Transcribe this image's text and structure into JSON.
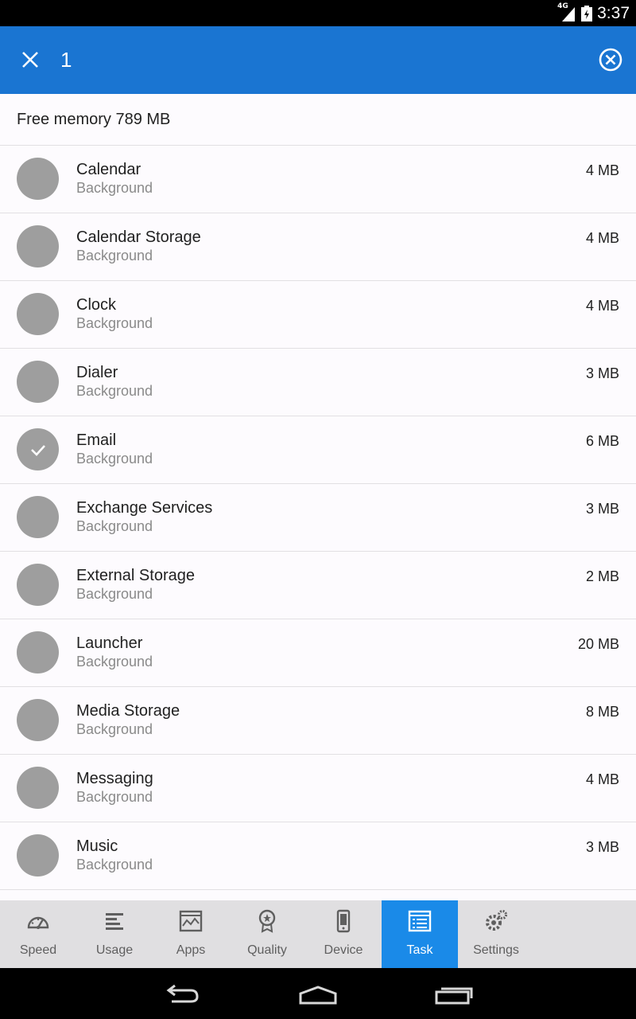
{
  "status_bar": {
    "network": "4G",
    "time": "3:37"
  },
  "action_bar": {
    "selected_count": "1",
    "close_icon": "close-icon",
    "clear_icon": "clear-circle-icon"
  },
  "free_memory": {
    "text": "Free memory 789 MB"
  },
  "tasks": [
    {
      "name": "Calendar",
      "status": "Background",
      "size": "4 MB",
      "selected": false
    },
    {
      "name": "Calendar Storage",
      "status": "Background",
      "size": "4 MB",
      "selected": false
    },
    {
      "name": "Clock",
      "status": "Background",
      "size": "4 MB",
      "selected": false
    },
    {
      "name": "Dialer",
      "status": "Background",
      "size": "3 MB",
      "selected": false
    },
    {
      "name": "Email",
      "status": "Background",
      "size": "6 MB",
      "selected": true
    },
    {
      "name": "Exchange Services",
      "status": "Background",
      "size": "3 MB",
      "selected": false
    },
    {
      "name": "External Storage",
      "status": "Background",
      "size": "2 MB",
      "selected": false
    },
    {
      "name": "Launcher",
      "status": "Background",
      "size": "20 MB",
      "selected": false
    },
    {
      "name": "Media Storage",
      "status": "Background",
      "size": "8 MB",
      "selected": false
    },
    {
      "name": "Messaging",
      "status": "Background",
      "size": "4 MB",
      "selected": false
    },
    {
      "name": "Music",
      "status": "Background",
      "size": "3 MB",
      "selected": false
    }
  ],
  "tabs": [
    {
      "label": "Speed",
      "icon": "speedometer-icon",
      "active": false
    },
    {
      "label": "Usage",
      "icon": "usage-bars-icon",
      "active": false
    },
    {
      "label": "Apps",
      "icon": "apps-chart-icon",
      "active": false
    },
    {
      "label": "Quality",
      "icon": "quality-badge-icon",
      "active": false
    },
    {
      "label": "Device",
      "icon": "device-phone-icon",
      "active": false
    },
    {
      "label": "Task",
      "icon": "task-list-icon",
      "active": true
    },
    {
      "label": "Settings",
      "icon": "settings-gears-icon",
      "active": false
    }
  ],
  "colors": {
    "primary": "#1a75d2",
    "active_tab": "#1a8ae8",
    "avatar": "#9e9e9e"
  }
}
